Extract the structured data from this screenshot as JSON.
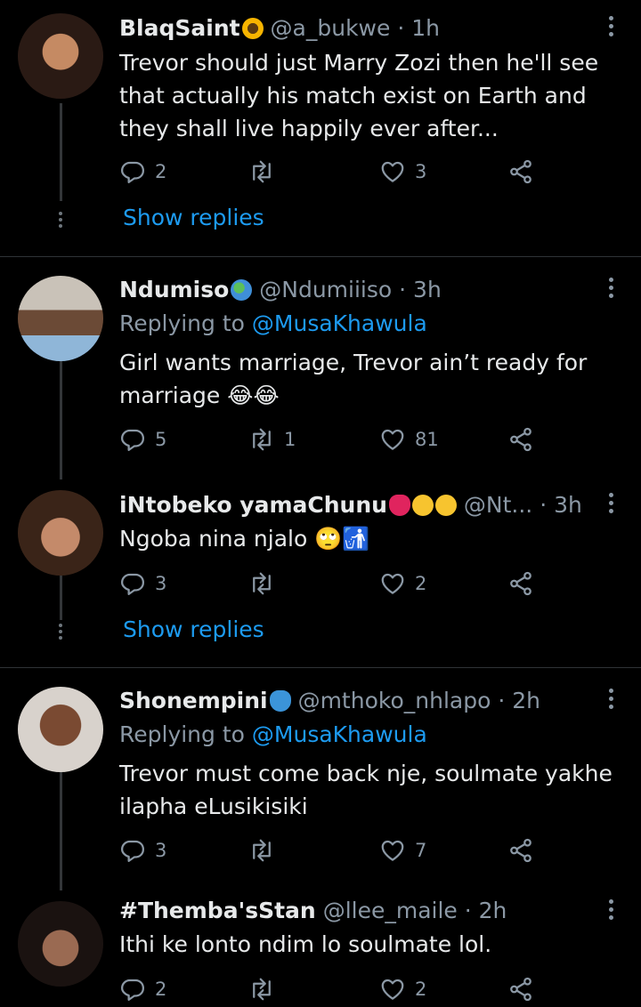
{
  "tweets": [
    {
      "name": "BlaqSaint",
      "name_emoji": "sunflower",
      "handle": "@a_bukwe",
      "time": "· 1h",
      "reply_to_prefix": "",
      "reply_to": "",
      "text": "Trevor should just Marry Zozi then he'll see that actually his match exist on Earth and they shall live happily ever after...",
      "replies": "2",
      "retweets": "",
      "likes": "3",
      "show_replies": "Show replies"
    },
    {
      "name": "Ndumiso",
      "name_emoji": "globe",
      "handle": "@Ndumiiiso",
      "time": "· 3h",
      "reply_to_prefix": "Replying to",
      "reply_to": "@MusaKhawula",
      "text": "Girl wants marriage, Trevor ain’t ready for marriage 😂😂",
      "replies": "5",
      "retweets": "1",
      "likes": "81",
      "show_replies": ""
    },
    {
      "name": "iNtobeko yamaChunu",
      "name_emoji": "heart, smiling-hearts, heart-eyes",
      "handle": "@Nt...",
      "time": "· 3h",
      "reply_to_prefix": "",
      "reply_to": "",
      "text": "Ngoba nina njalo 🙄🚮",
      "replies": "3",
      "retweets": "",
      "likes": "2",
      "show_replies": "Show replies"
    },
    {
      "name": "Shonempini",
      "name_emoji": "blue-heart",
      "handle": "@mthoko_nhlapo",
      "time": "· 2h",
      "reply_to_prefix": "Replying to",
      "reply_to": "@MusaKhawula",
      "text": "Trevor must come back nje, soulmate yakhe ilapha eLusikisiki",
      "replies": "3",
      "retweets": "",
      "likes": "7",
      "show_replies": ""
    },
    {
      "name": "#Themba'sStan",
      "name_emoji": "",
      "handle": "@llee_maile",
      "time": "· 2h",
      "reply_to_prefix": "",
      "reply_to": "",
      "text": "Ithi ke lonto ndim lo soulmate lol.",
      "replies": "2",
      "retweets": "",
      "likes": "2",
      "show_replies": ""
    }
  ],
  "colors": {
    "background": "#000000",
    "text": "#e7e9ea",
    "secondary": "#8b98a5",
    "accent": "#1d9bf0"
  },
  "icons": [
    "reply-icon",
    "retweet-icon",
    "like-icon",
    "share-icon",
    "more-icon"
  ]
}
